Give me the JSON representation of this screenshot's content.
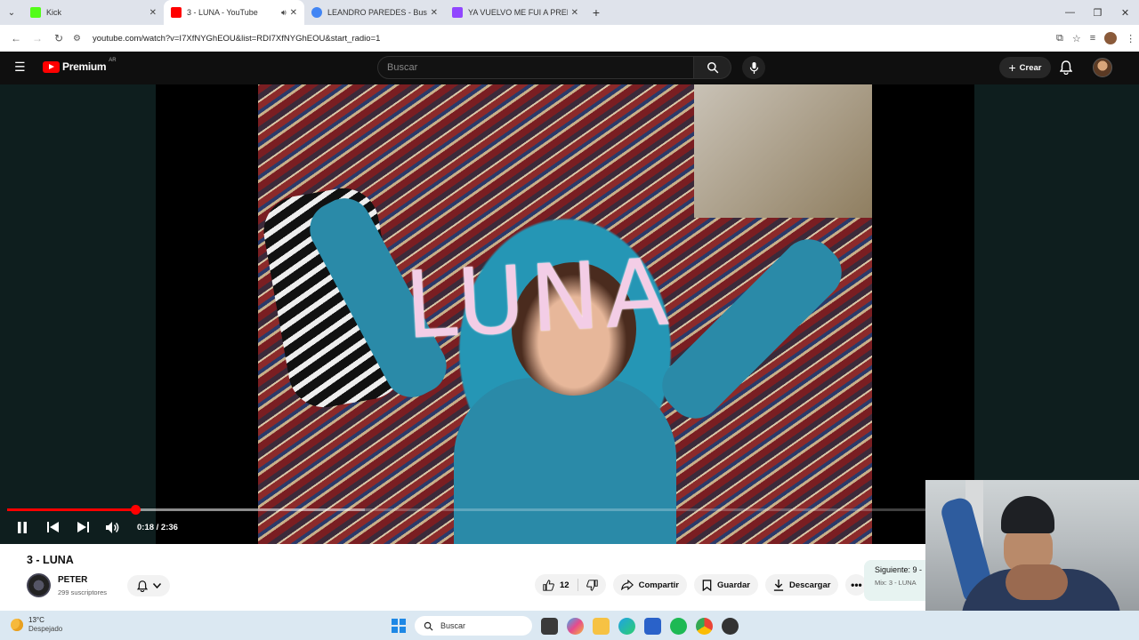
{
  "browser": {
    "tabs": [
      {
        "title": "Kick",
        "active": false,
        "favicon_color": "#53fc18"
      },
      {
        "title": "3 - LUNA - YouTube",
        "active": true,
        "favicon_color": "#ff0000"
      },
      {
        "title": "LEANDRO PAREDES - Buscar con",
        "active": false,
        "favicon_color": "#4285f4"
      },
      {
        "title": "YA VUELVO ME FUI A PREPARAR",
        "active": false,
        "favicon_color": "#9146ff"
      }
    ],
    "url": "youtube.com/watch?v=I7XfNYGhEOU&list=RDI7XfNYGhEOU&start_radio=1"
  },
  "youtube": {
    "logo_text": "Premium",
    "country_code": "AR",
    "search_placeholder": "Buscar",
    "create_label": "Crear",
    "accent": "#ff0000"
  },
  "player": {
    "overlay_text": "LUNA",
    "current_time": "0:18",
    "duration": "2:36",
    "time_display": "0:18 / 2:36",
    "progress_fraction": 0.14,
    "buffer_fraction": 0.39
  },
  "video": {
    "title": "3 - LUNA",
    "channel": "PETER",
    "subscribers": "299 suscriptores",
    "likes": "12",
    "share_label": "Compartir",
    "save_label": "Guardar",
    "download_label": "Descargar",
    "next_label": "Siguiente: 9 -",
    "mix_label": "Mix: 3 - LUNA"
  },
  "taskbar": {
    "temperature": "13°C",
    "condition": "Despejado",
    "search_placeholder": "Buscar"
  }
}
